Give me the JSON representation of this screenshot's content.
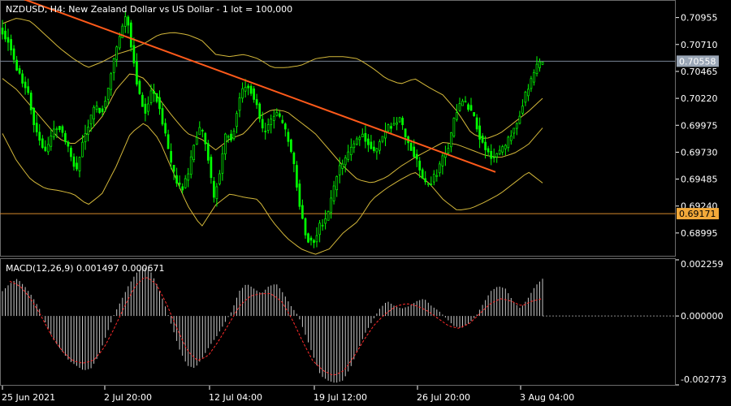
{
  "header": {
    "symbol_line": "NZDUSD, H4:  New Zealand Dollar vs US Dollar - 1 lot = 100,000"
  },
  "macd_panel": {
    "label": "MACD(12,26,9) 0.001497 0.000671"
  },
  "colors": {
    "background": "#000000",
    "candles": "#00ff00",
    "bollinger": "#d4b83a",
    "trendline": "#ff5a1a",
    "price_line": "#7a8696",
    "price_badge": "#9aa6b6",
    "level_line": "#d78a2a",
    "level_badge": "#f2a93a",
    "macd_histogram": "#c8c8c8",
    "macd_signal": "#ff2a2a",
    "axis_text": "#ffffff"
  },
  "chart_data": [
    {
      "type": "candlestick",
      "title": "NZDUSD, H4:  New Zealand Dollar vs US Dollar - 1 lot = 100,000",
      "x_ticks": [
        "25 Jun 2021",
        "2 Jul 20:00",
        "12 Jul 04:00",
        "19 Jul 12:00",
        "26 Jul 20:00",
        "3 Aug 04:00"
      ],
      "y_ticks": [
        "0.70955",
        "0.70710",
        "0.70465",
        "0.70220",
        "0.69975",
        "0.69730",
        "0.69485",
        "0.69240",
        "0.68995"
      ],
      "y_tick_values": [
        0.70955,
        0.7071,
        0.70465,
        0.7022,
        0.69975,
        0.6973,
        0.69485,
        0.6924,
        0.68995
      ],
      "ylim": [
        0.6878,
        0.711
      ],
      "current_price": "0.70558",
      "horizontal_level": "0.69171",
      "trendline": {
        "from": 0.7112,
        "to": 0.6955
      },
      "close_path": [
        0.7082,
        0.7075,
        0.7052,
        0.704,
        0.7031,
        0.7,
        0.6985,
        0.6972,
        0.699,
        0.6998,
        0.6985,
        0.697,
        0.6955,
        0.6985,
        0.7,
        0.7015,
        0.701,
        0.703,
        0.706,
        0.708,
        0.71,
        0.706,
        0.7025,
        0.701,
        0.703,
        0.702,
        0.6995,
        0.6965,
        0.6945,
        0.694,
        0.6955,
        0.6985,
        0.6995,
        0.6975,
        0.693,
        0.6955,
        0.699,
        0.6985,
        0.702,
        0.7035,
        0.703,
        0.7015,
        0.699,
        0.7,
        0.701,
        0.7,
        0.6985,
        0.696,
        0.692,
        0.6895,
        0.689,
        0.6905,
        0.691,
        0.693,
        0.6955,
        0.6965,
        0.6975,
        0.6985,
        0.699,
        0.698,
        0.6972,
        0.6985,
        0.6995,
        0.6998,
        0.7003,
        0.6985,
        0.6975,
        0.696,
        0.6945,
        0.6945,
        0.6955,
        0.697,
        0.698,
        0.701,
        0.702,
        0.7015,
        0.7005,
        0.6985,
        0.6975,
        0.6968,
        0.6972,
        0.6978,
        0.699,
        0.7002,
        0.7022,
        0.7035,
        0.705,
        0.7056
      ],
      "series": [
        {
          "kind": "bollinger_upper",
          "values": [
            0.709,
            0.7095,
            0.7092,
            0.708,
            0.7068,
            0.7058,
            0.705,
            0.7055,
            0.7062,
            0.7066,
            0.7072,
            0.708,
            0.7082,
            0.708,
            0.7075,
            0.7062,
            0.706,
            0.7062,
            0.7058,
            0.705,
            0.705,
            0.7052,
            0.7058,
            0.706,
            0.706,
            0.7058,
            0.705,
            0.704,
            0.7035,
            0.704,
            0.7032,
            0.7025,
            0.701,
            0.699,
            0.6985,
            0.699,
            0.7,
            0.701,
            0.7022
          ]
        },
        {
          "kind": "bollinger_middle",
          "values": [
            0.704,
            0.703,
            0.7015,
            0.7,
            0.6985,
            0.698,
            0.699,
            0.7005,
            0.703,
            0.7045,
            0.704,
            0.7022,
            0.7005,
            0.699,
            0.6985,
            0.6975,
            0.6985,
            0.699,
            0.7005,
            0.7012,
            0.701,
            0.7,
            0.699,
            0.6975,
            0.696,
            0.6948,
            0.6945,
            0.695,
            0.696,
            0.6968,
            0.6975,
            0.6982,
            0.698,
            0.6975,
            0.697,
            0.6968,
            0.6972,
            0.698,
            0.6995
          ]
        },
        {
          "kind": "bollinger_lower",
          "values": [
            0.699,
            0.6965,
            0.6948,
            0.694,
            0.6938,
            0.6935,
            0.6925,
            0.6935,
            0.696,
            0.699,
            0.7,
            0.6985,
            0.6955,
            0.6925,
            0.6905,
            0.6925,
            0.6935,
            0.6932,
            0.693,
            0.691,
            0.6895,
            0.6885,
            0.688,
            0.6885,
            0.69,
            0.691,
            0.693,
            0.694,
            0.6948,
            0.6955,
            0.6945,
            0.693,
            0.692,
            0.6922,
            0.6928,
            0.6935,
            0.6945,
            0.6955,
            0.6945
          ]
        }
      ]
    },
    {
      "type": "bar",
      "title": "MACD(12,26,9) 0.001497 0.000671",
      "y_ticks": [
        "0.002259",
        "0.000000",
        "-0.002773"
      ],
      "y_tick_values": [
        0.002259,
        0.0,
        -0.002773
      ],
      "ylim": [
        -0.002773,
        0.002259
      ],
      "macd": {
        "value": 0.001497,
        "signal_value": 0.000671
      },
      "macd_path": [
        0.001,
        0.0013,
        0.0015,
        0.0012,
        0.0008,
        0.0003,
        -0.0004,
        -0.001,
        -0.0014,
        -0.0018,
        -0.002,
        -0.0022,
        -0.0021,
        -0.0016,
        -0.0008,
        0.0,
        0.0006,
        0.0012,
        0.0017,
        0.002,
        0.0018,
        0.0012,
        0.0004,
        -0.0005,
        -0.0014,
        -0.002,
        -0.0021,
        -0.0017,
        -0.0012,
        -0.0008,
        -0.0003,
        0.0002,
        0.001,
        0.0013,
        0.0011,
        0.0009,
        0.0012,
        0.0013,
        0.0009,
        0.0004,
        0.0,
        -0.0008,
        -0.0016,
        -0.0024,
        -0.0026,
        -0.0027,
        -0.0026,
        -0.0021,
        -0.0014,
        -0.0007,
        -0.0002,
        0.0003,
        0.0006,
        0.0004,
        0.0003,
        0.0004,
        0.0006,
        0.0007,
        0.0004,
        0.0002,
        -0.0001,
        -0.0004,
        -0.0005,
        -0.0003,
        0.0,
        0.0005,
        0.001,
        0.0012,
        0.0011,
        0.0006,
        0.0003,
        0.0007,
        0.0012,
        0.0015
      ],
      "signal_path": [
        0.0014,
        0.0012,
        0.0007,
        0.0,
        -0.0008,
        -0.0014,
        -0.0018,
        -0.0019,
        -0.0018,
        -0.0013,
        -0.0005,
        0.0004,
        0.0012,
        0.0016,
        0.0013,
        0.0005,
        -0.0005,
        -0.0014,
        -0.0018,
        -0.0016,
        -0.001,
        -0.0003,
        0.0004,
        0.0008,
        0.0009,
        0.0009,
        0.0006,
        -0.0001,
        -0.001,
        -0.0018,
        -0.0022,
        -0.0024,
        -0.0022,
        -0.0016,
        -0.0009,
        -0.0003,
        0.0001,
        0.0004,
        0.0005,
        0.0004,
        0.0002,
        -0.0001,
        -0.0004,
        -0.0005,
        -0.0003,
        0.0001,
        0.0005,
        0.0007,
        0.0006,
        0.0004,
        0.0006,
        0.0007
      ]
    }
  ]
}
